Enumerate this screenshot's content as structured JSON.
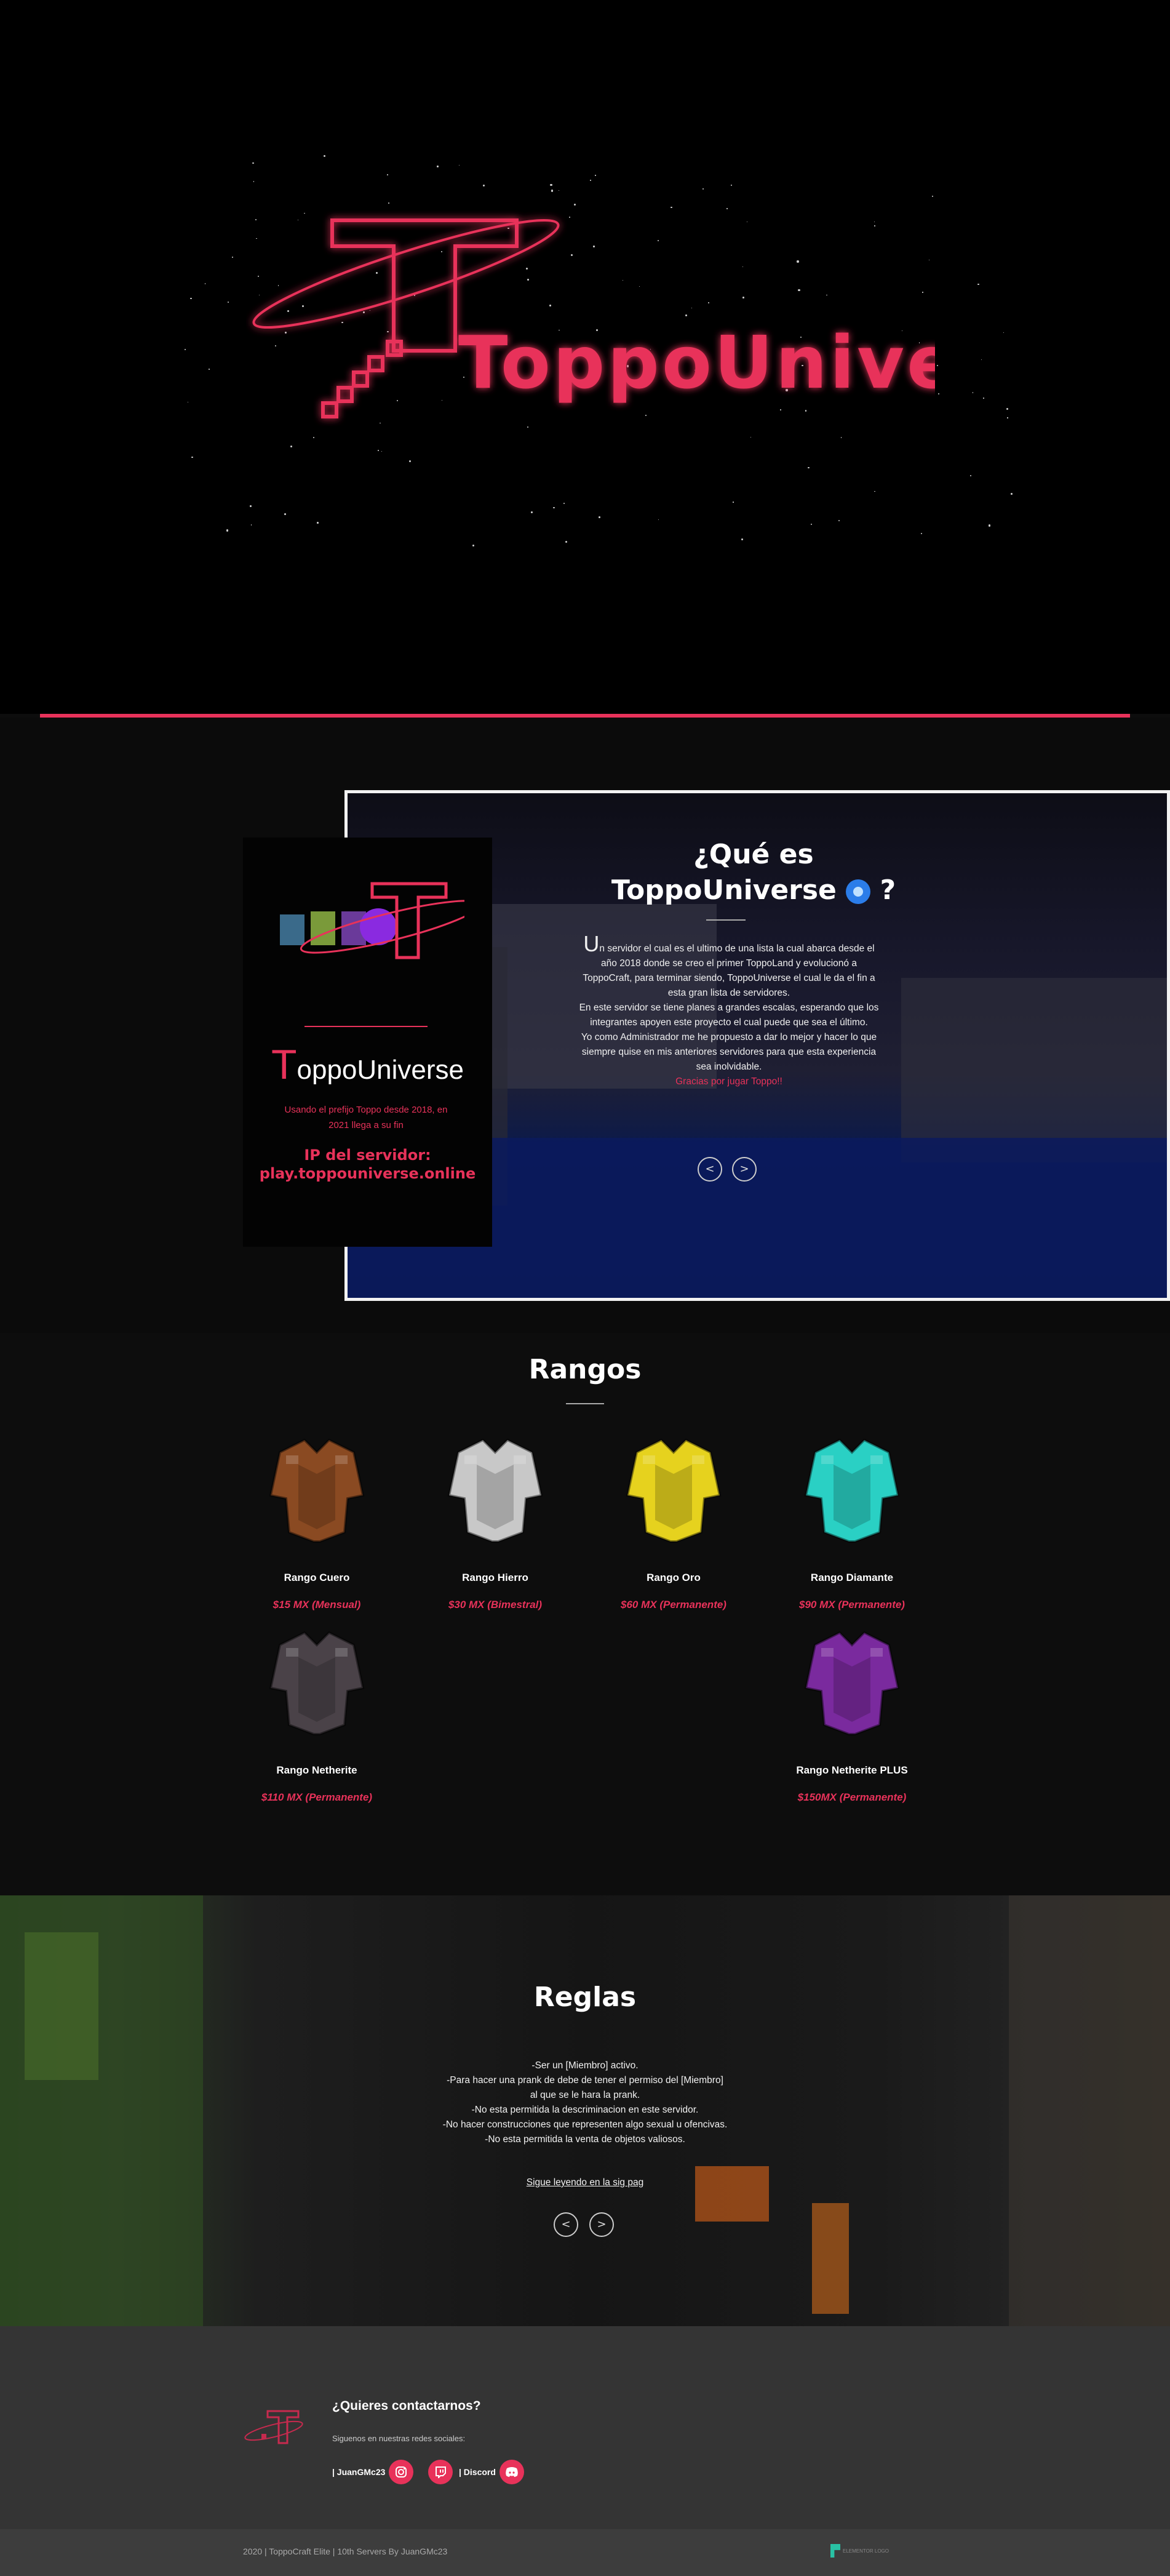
{
  "hero": {
    "logo_text": "ToppoUniverse",
    "accent_color": "#e8325a"
  },
  "about": {
    "card": {
      "brand_initial": "T",
      "brand_rest": "oppoUniverse",
      "tagline": "Usando el prefijo Toppo desde 2018, en 2021 llega a su fin",
      "ip_label": "IP del servidor:",
      "ip_value": "play.toppouniverse.online"
    },
    "title_line1": "¿Qué es",
    "title_line2": "ToppoUniverse",
    "title_suffix": "?",
    "dropcap": "U",
    "paragraph1": "n servidor el cual es el ultimo de una lista la cual abarca desde el año 2018 donde se creo el primer ToppoLand y evolucionó a ToppoCraft, para terminar siendo, ToppoUniverse el cual le da el fin a esta gran lista de servidores.",
    "paragraph2": "En este servidor se tiene planes a grandes escalas, esperando que los integrantes apoyen este proyecto el cual puede que sea el último.",
    "paragraph3": "Yo como Administrador me he propuesto a dar lo mejor y hacer lo que siempre quise en mis anteriores servidores para que esta experiencia sea inolvidable.",
    "thanks": "Gracias por jugar Toppo!!",
    "prev_label": "<",
    "next_label": ">"
  },
  "rangos": {
    "title": "Rangos",
    "items": [
      {
        "name": "Rango Cuero",
        "price": "$15 MX (Mensual)",
        "color": "#8a4a22"
      },
      {
        "name": "Rango Hierro",
        "price": "$30 MX (Bimestral)",
        "color": "#c8c8c8"
      },
      {
        "name": "Rango Oro",
        "price": "$60 MX (Permanente)",
        "color": "#e6d21e"
      },
      {
        "name": "Rango Diamante",
        "price": "$90 MX (Permanente)",
        "color": "#2ad0c4"
      },
      {
        "name": "Rango Netherite",
        "price": "$110 MX (Permanente)",
        "color": "#4a4248"
      },
      {
        "name": "Rango Netherite PLUS",
        "price": "$150MX (Permanente)",
        "color": "#7a2a9e"
      }
    ]
  },
  "reglas": {
    "title": "Reglas",
    "rules": [
      "-Ser un [Miembro] activo.",
      "-Para hacer una prank de debe de tener el permiso del [Miembro]",
      "al que se le hara la prank.",
      "-No esta permitida la descriminacion en este servidor.",
      "-No hacer construcciones que representen algo sexual u ofencivas.",
      "-No esta permitida la venta de objetos valiosos."
    ],
    "more_link": "Sigue leyendo en la sig pag",
    "prev_label": "<",
    "next_label": ">"
  },
  "contact": {
    "title": "¿Quieres contactarnos?",
    "subtitle": "Siguenos en nuestras redes sociales:",
    "instagram_label": "| JuanGMc23",
    "discord_label": "| Discord"
  },
  "footer": {
    "text": "2020 | ToppoCraft Elite | 10th Servers By JuanGMc23",
    "badge": "ELEMENTOR LOGO"
  }
}
